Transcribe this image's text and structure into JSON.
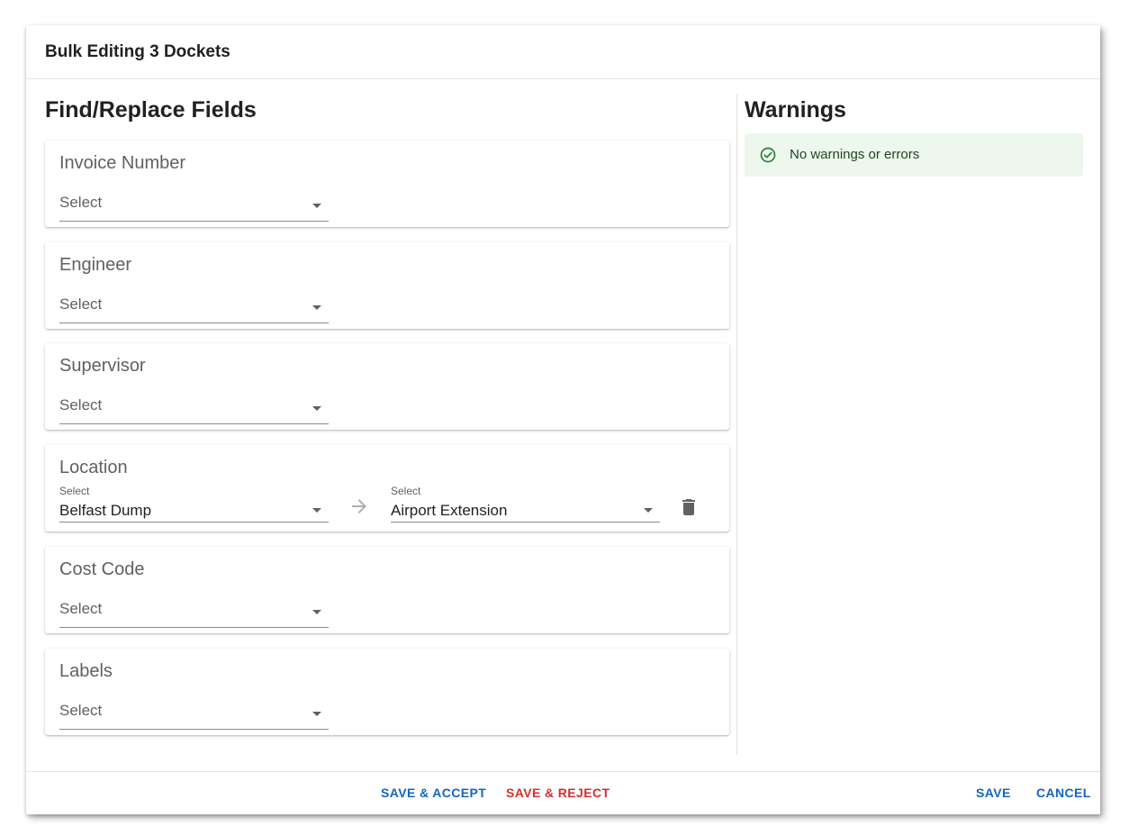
{
  "dialog": {
    "title": "Bulk Editing 3 Dockets"
  },
  "left": {
    "heading": "Find/Replace Fields"
  },
  "fields": {
    "invoice": {
      "title": "Invoice Number",
      "placeholder": "Select"
    },
    "engineer": {
      "title": "Engineer",
      "placeholder": "Select"
    },
    "supervisor": {
      "title": "Supervisor",
      "placeholder": "Select"
    },
    "location": {
      "title": "Location",
      "find": {
        "label": "Select",
        "value": "Belfast Dump"
      },
      "replace": {
        "label": "Select",
        "value": "Airport Extension"
      }
    },
    "costcode": {
      "title": "Cost Code",
      "placeholder": "Select"
    },
    "labels": {
      "title": "Labels",
      "placeholder": "Select"
    }
  },
  "warnings": {
    "heading": "Warnings",
    "message": "No warnings or errors"
  },
  "footer": {
    "save_accept": "SAVE & ACCEPT",
    "save_reject": "SAVE & REJECT",
    "save": "SAVE",
    "cancel": "CANCEL"
  },
  "colors": {
    "primary": "#1565c0",
    "danger": "#d32f2f",
    "success_bg": "#edf7ed",
    "success_icon": "#2e7d32"
  },
  "icons": {
    "dropdown": "chevron-down-icon",
    "replace_arrow": "arrow-right-icon",
    "delete": "trash-icon",
    "success": "check-circle-icon"
  }
}
